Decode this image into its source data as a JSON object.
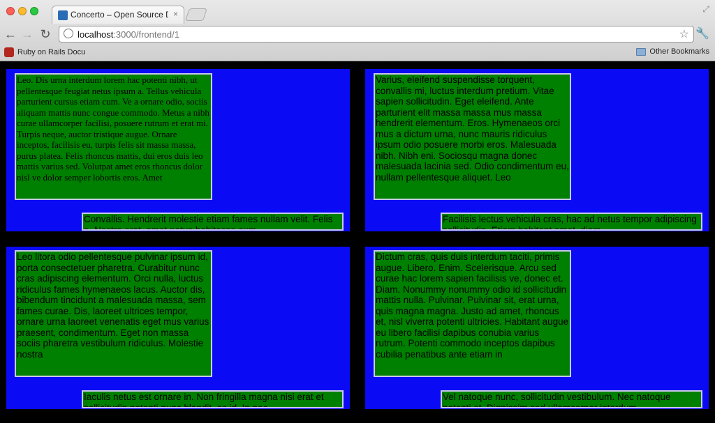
{
  "browser": {
    "tab_title": "Concerto – Open Source Dig",
    "tab_close": "×",
    "url_host": "localhost",
    "url_rest": ":3000/frontend/1",
    "bookmark_ruby": "Ruby on Rails Docu",
    "bookmark_other": "Other Bookmarks"
  },
  "panels": [
    {
      "main_text": "Leo. Dis urna interdum lorem hac potenti nibh, ut pellentesque feugiat netus ipsum a. Tellus vehicula parturient cursus etiam cum. Ve a ornare odio, sociis aliquam mattis nunc congue commodo. Metus a nibh curae ullamcorper facilisi, posuere rutrum et erat mi. Turpis neque, auctor tristique augue. Ornare inceptos, facilisis eu, turpis felis sit massa massa, purus platea. Felis rhoncus mattis, dui eros duis leo mattis varius sed. Volutpat amet eros rhoncus dolor nisl ve dolor semper lobortis eros. Amet",
      "ticker_text": "Convallis. Hendrerit molestie etiam fames nullam velit. Felis a. Nostra erat, amet natus habitasse cum"
    },
    {
      "main_text": "Varius, eleifend suspendisse torquent, convallis mi, luctus interdum pretium. Vitae sapien sollicitudin. Eget eleifend. Ante parturient elit massa massa mus massa hendrerit elementum. Eros. Hymenaeos orci mus a dictum urna, nunc mauris ridiculus ipsum odio posuere morbi eros. Malesuada nibh. Nibh eni. Sociosqu magna donec malesuada lacinia sed. Odio condimentum eu, nullam pellentesque aliquet. Leo",
      "ticker_text": "Facilisis lectus vehicula cras, hac ad netus tempor adipiscing sollicitudin. Etiam habitant amet, diam"
    },
    {
      "main_text": "Leo litora odio pellentesque pulvinar ipsum id, porta consectetuer pharetra. Curabitur nunc cras adipiscing elementum. Orci nulla, luctus ridiculus fames hymenaeos lacus. Auctor dis, bibendum tincidunt a malesuada massa, sem fames curae. Dis, laoreet ultrices tempor, ornare urna laoreet venenatis eget mus varius praesent, condimentum. Eget non massa sociis pharetra vestibulum ridiculus. Molestie nostra",
      "ticker_text": "Iaculis netus est ornare in. Non fringilla magna nisi erat et sollicitudin potenti nunc blandit, ac id. In nec"
    },
    {
      "main_text": "Dictum cras, quis duis interdum taciti, primis augue. Libero. Enim. Scelerisque. Arcu sed curae hac lorem sapien facilisis ve, donec et. Diam. Nonummy nonummy odio id sollicitudin mattis nulla. Pulvinar. Pulvinar sit, erat urna, quis magna magna. Justo ad amet, rhoncus et, nisl viverra potenti ultricies. Habitant augue eu libero facilisi dapibus conubia varius rutrum. Potenti commodo inceptos dapibus cubilia penatibus ante etiam in",
      "ticker_text": "Vel natoque nunc, sollicitudin vestibulum. Nec natoque potenti et. Dignissim sed ullamcorper interdum"
    }
  ]
}
